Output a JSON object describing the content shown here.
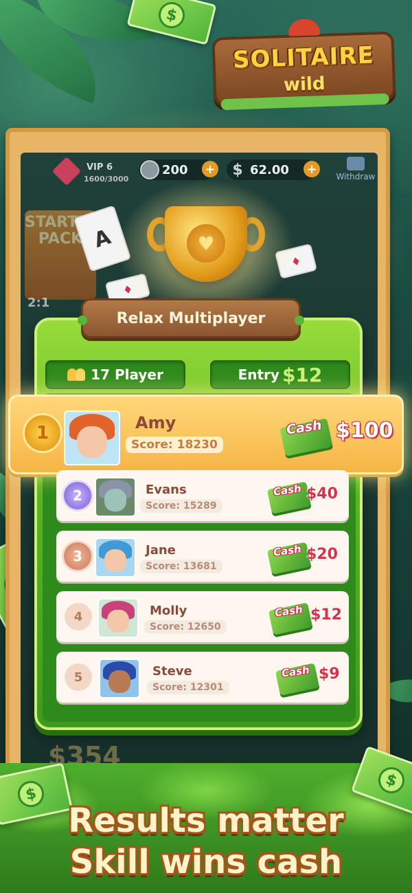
{
  "logo": {
    "title": "SOLITAIRE",
    "subtitle": "wild"
  },
  "topbar": {
    "vip_label": "VIP 6",
    "vip_progress": "1600/3000",
    "coins": "200",
    "cash": "62.00",
    "withdraw_label": "Withdraw"
  },
  "background": {
    "starter_pack": "STARTER PACK",
    "timer": "2:1",
    "bg_amount": "$354"
  },
  "mode": {
    "title": "Relax Multiplayer",
    "players": "17 Player",
    "entry_label": "Entry",
    "entry_amount": "$12"
  },
  "leaderboard": [
    {
      "rank": "1",
      "name": "Amy",
      "score": "Score: 18230",
      "cash_label": "Cash",
      "prize": "$100",
      "hair_color": "#e0642a"
    },
    {
      "rank": "2",
      "name": "Evans",
      "score": "Score: 15289",
      "cash_label": "Cash",
      "prize": "$40",
      "hair_color": "#8a93a8"
    },
    {
      "rank": "3",
      "name": "Jane",
      "score": "Score: 13681",
      "cash_label": "Cash",
      "prize": "$20",
      "hair_color": "#3f9ad6"
    },
    {
      "rank": "4",
      "name": "Molly",
      "score": "Score: 12650",
      "cash_label": "Cash",
      "prize": "$12",
      "hair_color": "#c8437a"
    },
    {
      "rank": "5",
      "name": "Steve",
      "score": "Score: 12301",
      "cash_label": "Cash",
      "prize": "$9",
      "hair_color": "#2a4ca8"
    }
  ],
  "tagline": {
    "line1": "Results matter",
    "line2": "Skill wins cash"
  },
  "colors": {
    "panel_green": "#5cb524",
    "gold_row": "#f6b545",
    "prize_red": "#d6334b",
    "name_brown": "#8b4a3a"
  }
}
